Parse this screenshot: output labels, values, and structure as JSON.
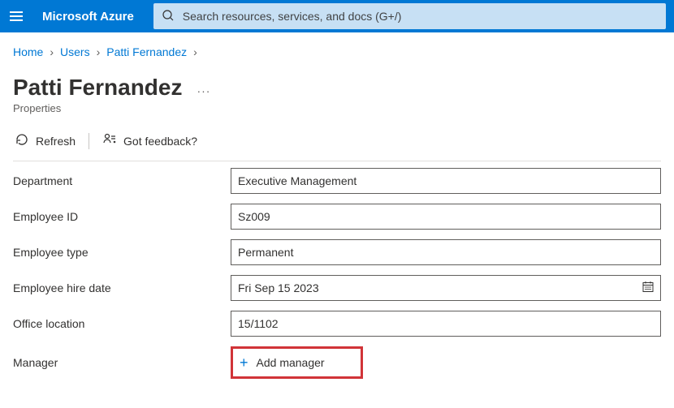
{
  "header": {
    "brand": "Microsoft Azure",
    "search_placeholder": "Search resources, services, and docs (G+/)"
  },
  "breadcrumb": {
    "items": [
      "Home",
      "Users",
      "Patti Fernandez"
    ]
  },
  "page": {
    "title": "Patti Fernandez",
    "subtitle": "Properties"
  },
  "toolbar": {
    "refresh": "Refresh",
    "feedback": "Got feedback?"
  },
  "form": {
    "department": {
      "label": "Department",
      "value": "Executive Management"
    },
    "employee_id": {
      "label": "Employee ID",
      "value": "Sz009"
    },
    "employee_type": {
      "label": "Employee type",
      "value": "Permanent"
    },
    "hire_date": {
      "label": "Employee hire date",
      "value": "Fri Sep 15 2023"
    },
    "office_location": {
      "label": "Office location",
      "value": "15/1102"
    },
    "manager": {
      "label": "Manager",
      "add_label": "Add manager"
    }
  }
}
